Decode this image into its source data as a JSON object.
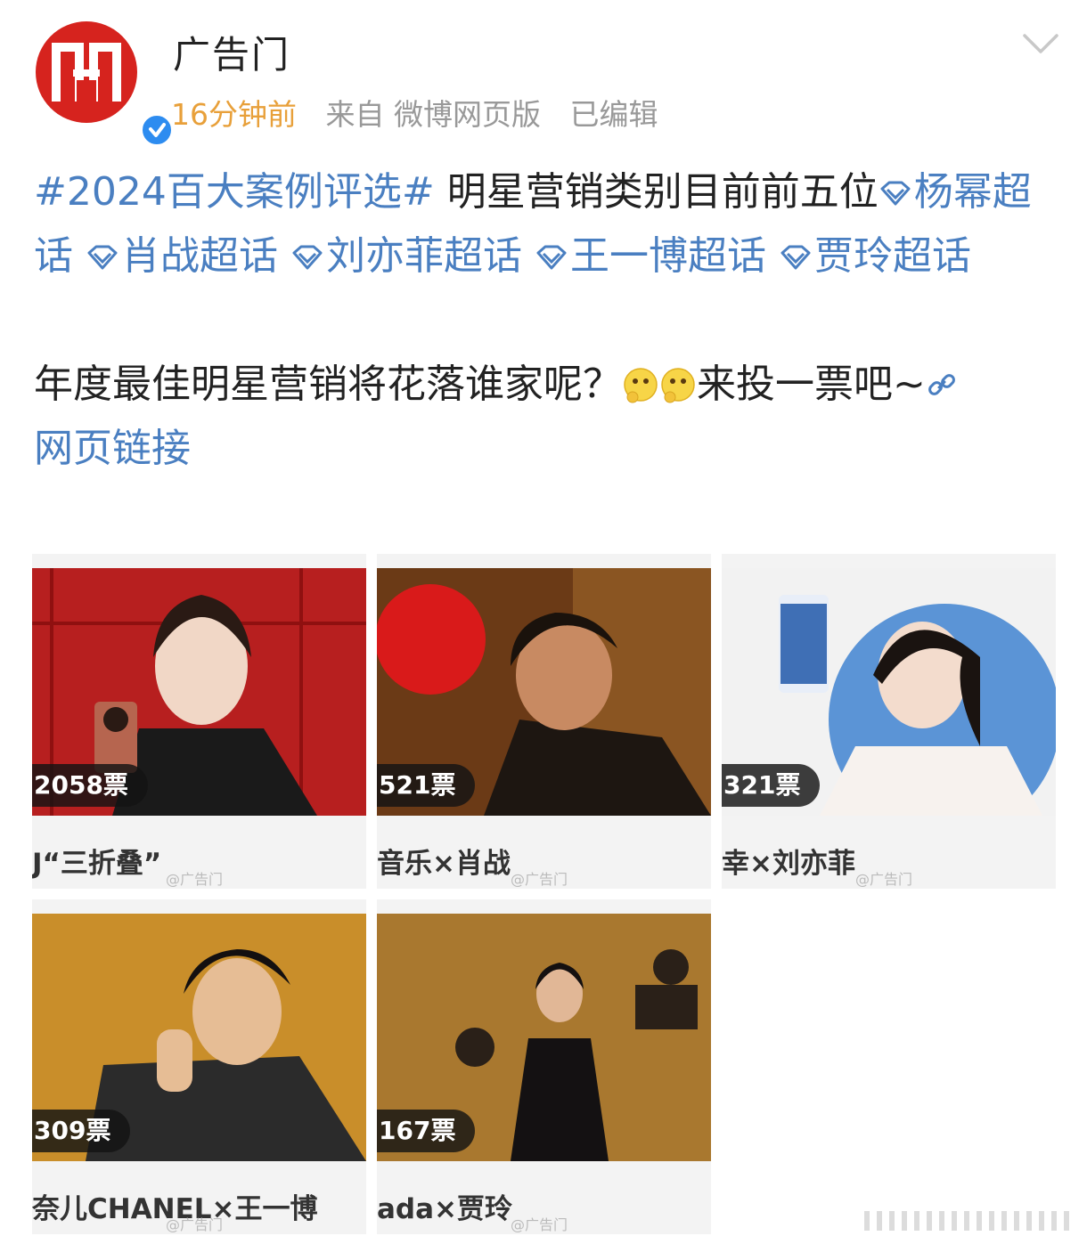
{
  "header": {
    "username": "广告门",
    "time": "16分钟前",
    "source": "来自 微博网页版",
    "edited": "已编辑"
  },
  "post": {
    "hashtag": "#2024百大案例评选#",
    "line1_text": " 明星营销类别目前前五位",
    "topics": [
      "杨幂超话",
      "肖战超话",
      "刘亦菲超话",
      "王一博超话",
      "贾玲超话"
    ],
    "para2_text": "年度最佳明星营销将花落谁家呢？",
    "para2_suffix": "来投一票吧~",
    "link_label": "网页链接"
  },
  "images": [
    {
      "votes": "2058票",
      "caption": "J“三折叠”",
      "watermark": "@广告门"
    },
    {
      "votes": "521票",
      "caption": "音乐×肖战",
      "watermark": "@广告门"
    },
    {
      "votes": "321票",
      "caption": "幸×刘亦菲",
      "watermark": "@广告门"
    },
    {
      "votes": "309票",
      "caption": "奈儿CHANEL×王一博",
      "watermark": "@广告门"
    },
    {
      "votes": "167票",
      "caption": "ada×贾玲",
      "watermark": "@广告门"
    }
  ],
  "colors": {
    "accent": "#4a7fc1",
    "time": "#e8a03a",
    "brand": "#d6231e",
    "verify": "#2d8cf0"
  }
}
